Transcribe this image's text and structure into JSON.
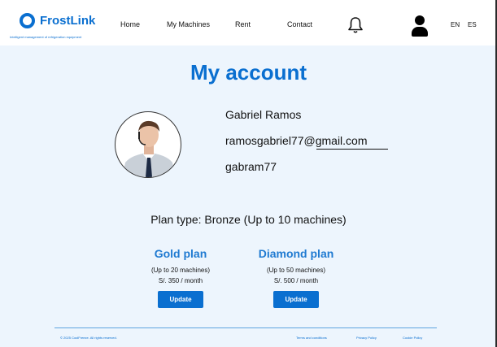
{
  "brand": {
    "name": "FrostLink",
    "tagline": "Intelligent management of refrigeration equipment"
  },
  "nav": {
    "home": "Home",
    "machines": "My Machines",
    "rent": "Rent",
    "contact": "Contact"
  },
  "icons": {
    "notifications": "bell-icon",
    "account": "user-icon"
  },
  "languages": {
    "en": "EN",
    "es": "ES"
  },
  "page": {
    "title": "My account"
  },
  "profile": {
    "name": "Gabriel Ramos",
    "email": "ramosgabriel77@gmail.com",
    "username": "gabram77"
  },
  "plan_type": "Plan type: Bronze (Up to 10 machines)",
  "plans": [
    {
      "title": "Gold plan",
      "limit": "(Up to 20 machines)",
      "price": "S/. 350 / month",
      "button": "Update"
    },
    {
      "title": "Diamond plan",
      "limit": "(Up to 50 machines)",
      "price": "S/. 500 / month",
      "button": "Update"
    }
  ],
  "footer": {
    "copyright": "© 2025 CoolFreeze. All rights reserved.",
    "terms": "Terms and conditions",
    "privacy": "Privacy Policy",
    "cookies": "Cookie Policy"
  },
  "colors": {
    "brand": "#0a6fd0",
    "background": "#edf5fd"
  }
}
